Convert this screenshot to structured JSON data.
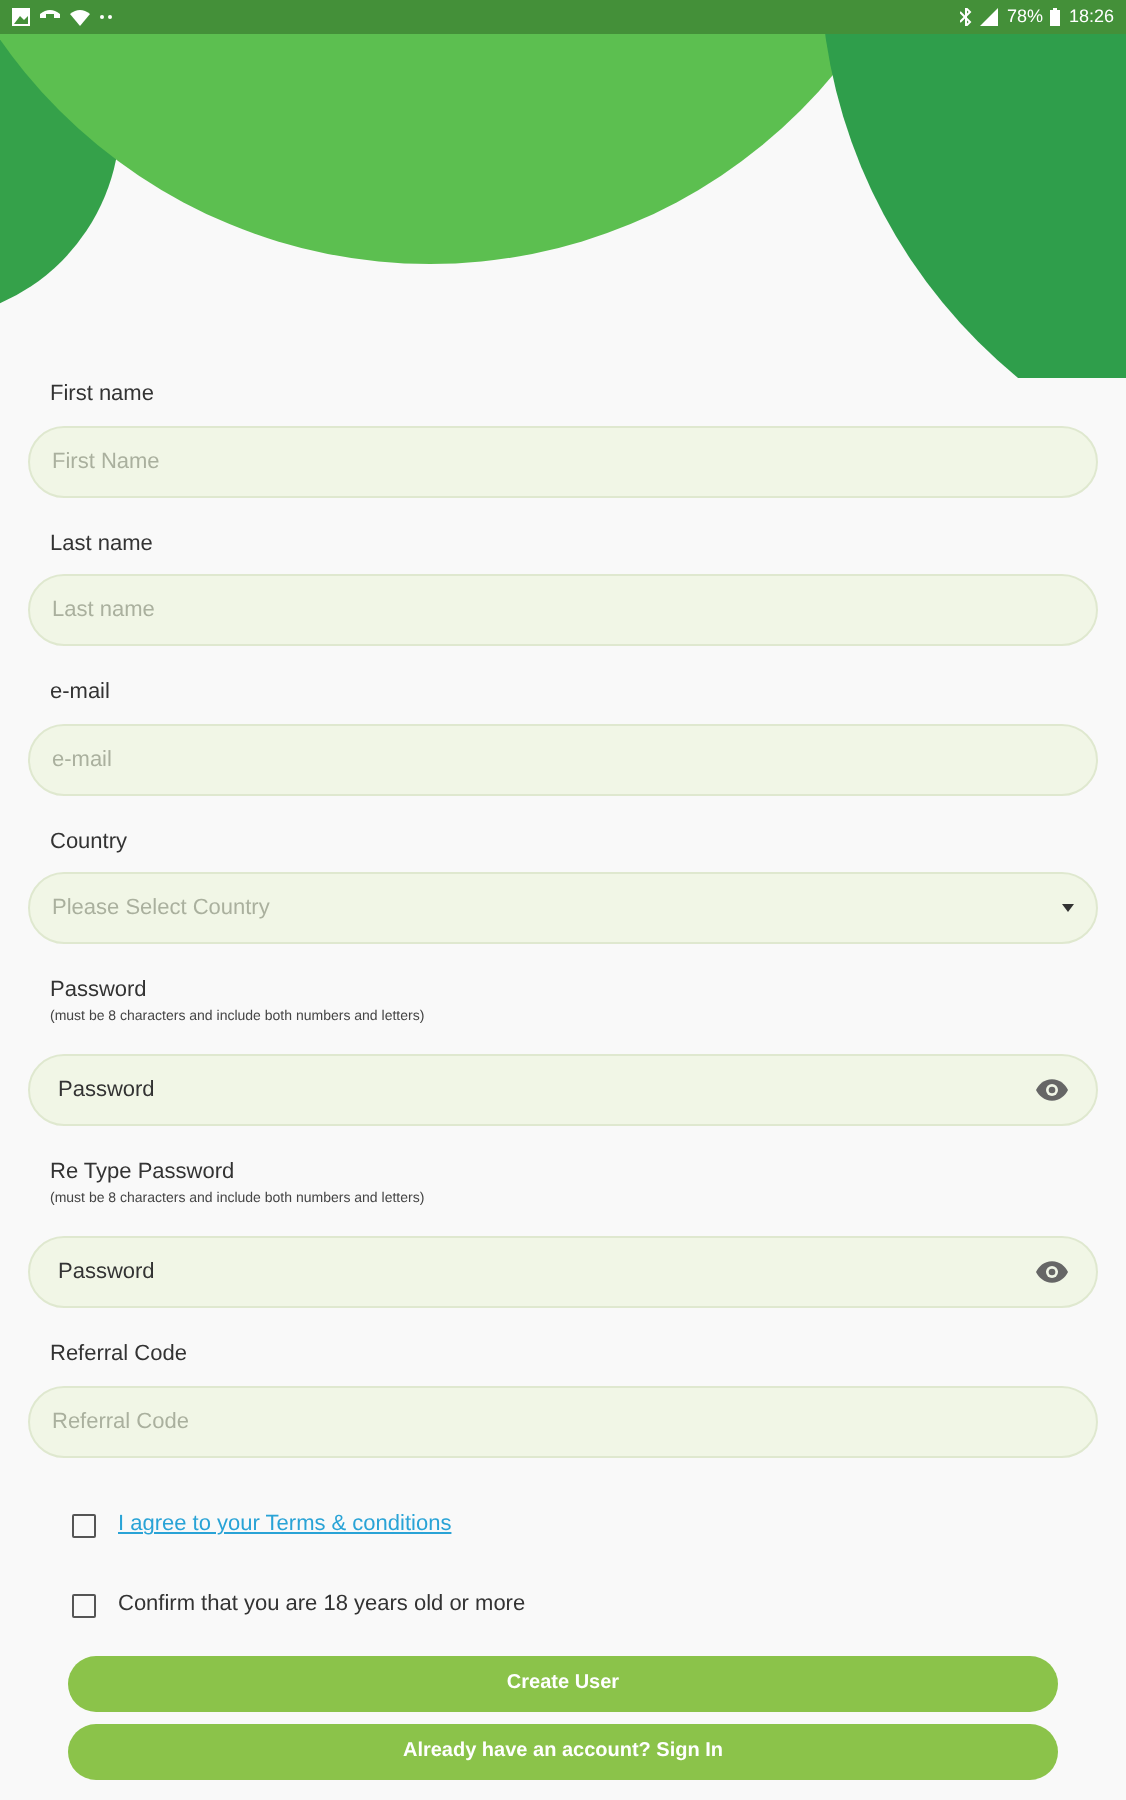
{
  "status_bar": {
    "battery": "78%",
    "time": "18:26"
  },
  "fields": [
    {
      "kind": "text",
      "label": "First name",
      "placeholder": "First Name"
    },
    {
      "kind": "text",
      "label": "Last name",
      "placeholder": "Last name"
    },
    {
      "kind": "text",
      "label": "e-mail",
      "placeholder": "e-mail"
    },
    {
      "kind": "select",
      "label": "Country",
      "placeholder": "Please Select Country"
    },
    {
      "kind": "password",
      "label": "Password",
      "hint": "(must be 8 characters and include both numbers and letters)",
      "value": "Password"
    },
    {
      "kind": "password",
      "label": "Re Type Password",
      "hint": "(must be 8 characters and include both numbers and letters)",
      "value": "Password"
    },
    {
      "kind": "text",
      "label": "Referral Code",
      "placeholder": "Referral Code"
    }
  ],
  "checkboxes": [
    {
      "kind": "link",
      "label": "I agree to your Terms & conditions",
      "checked": false
    },
    {
      "kind": "text",
      "label": "Confirm that you are 18 years old or more",
      "checked": false
    }
  ],
  "buttons": [
    "Create User",
    "Already have an account? Sign In"
  ]
}
